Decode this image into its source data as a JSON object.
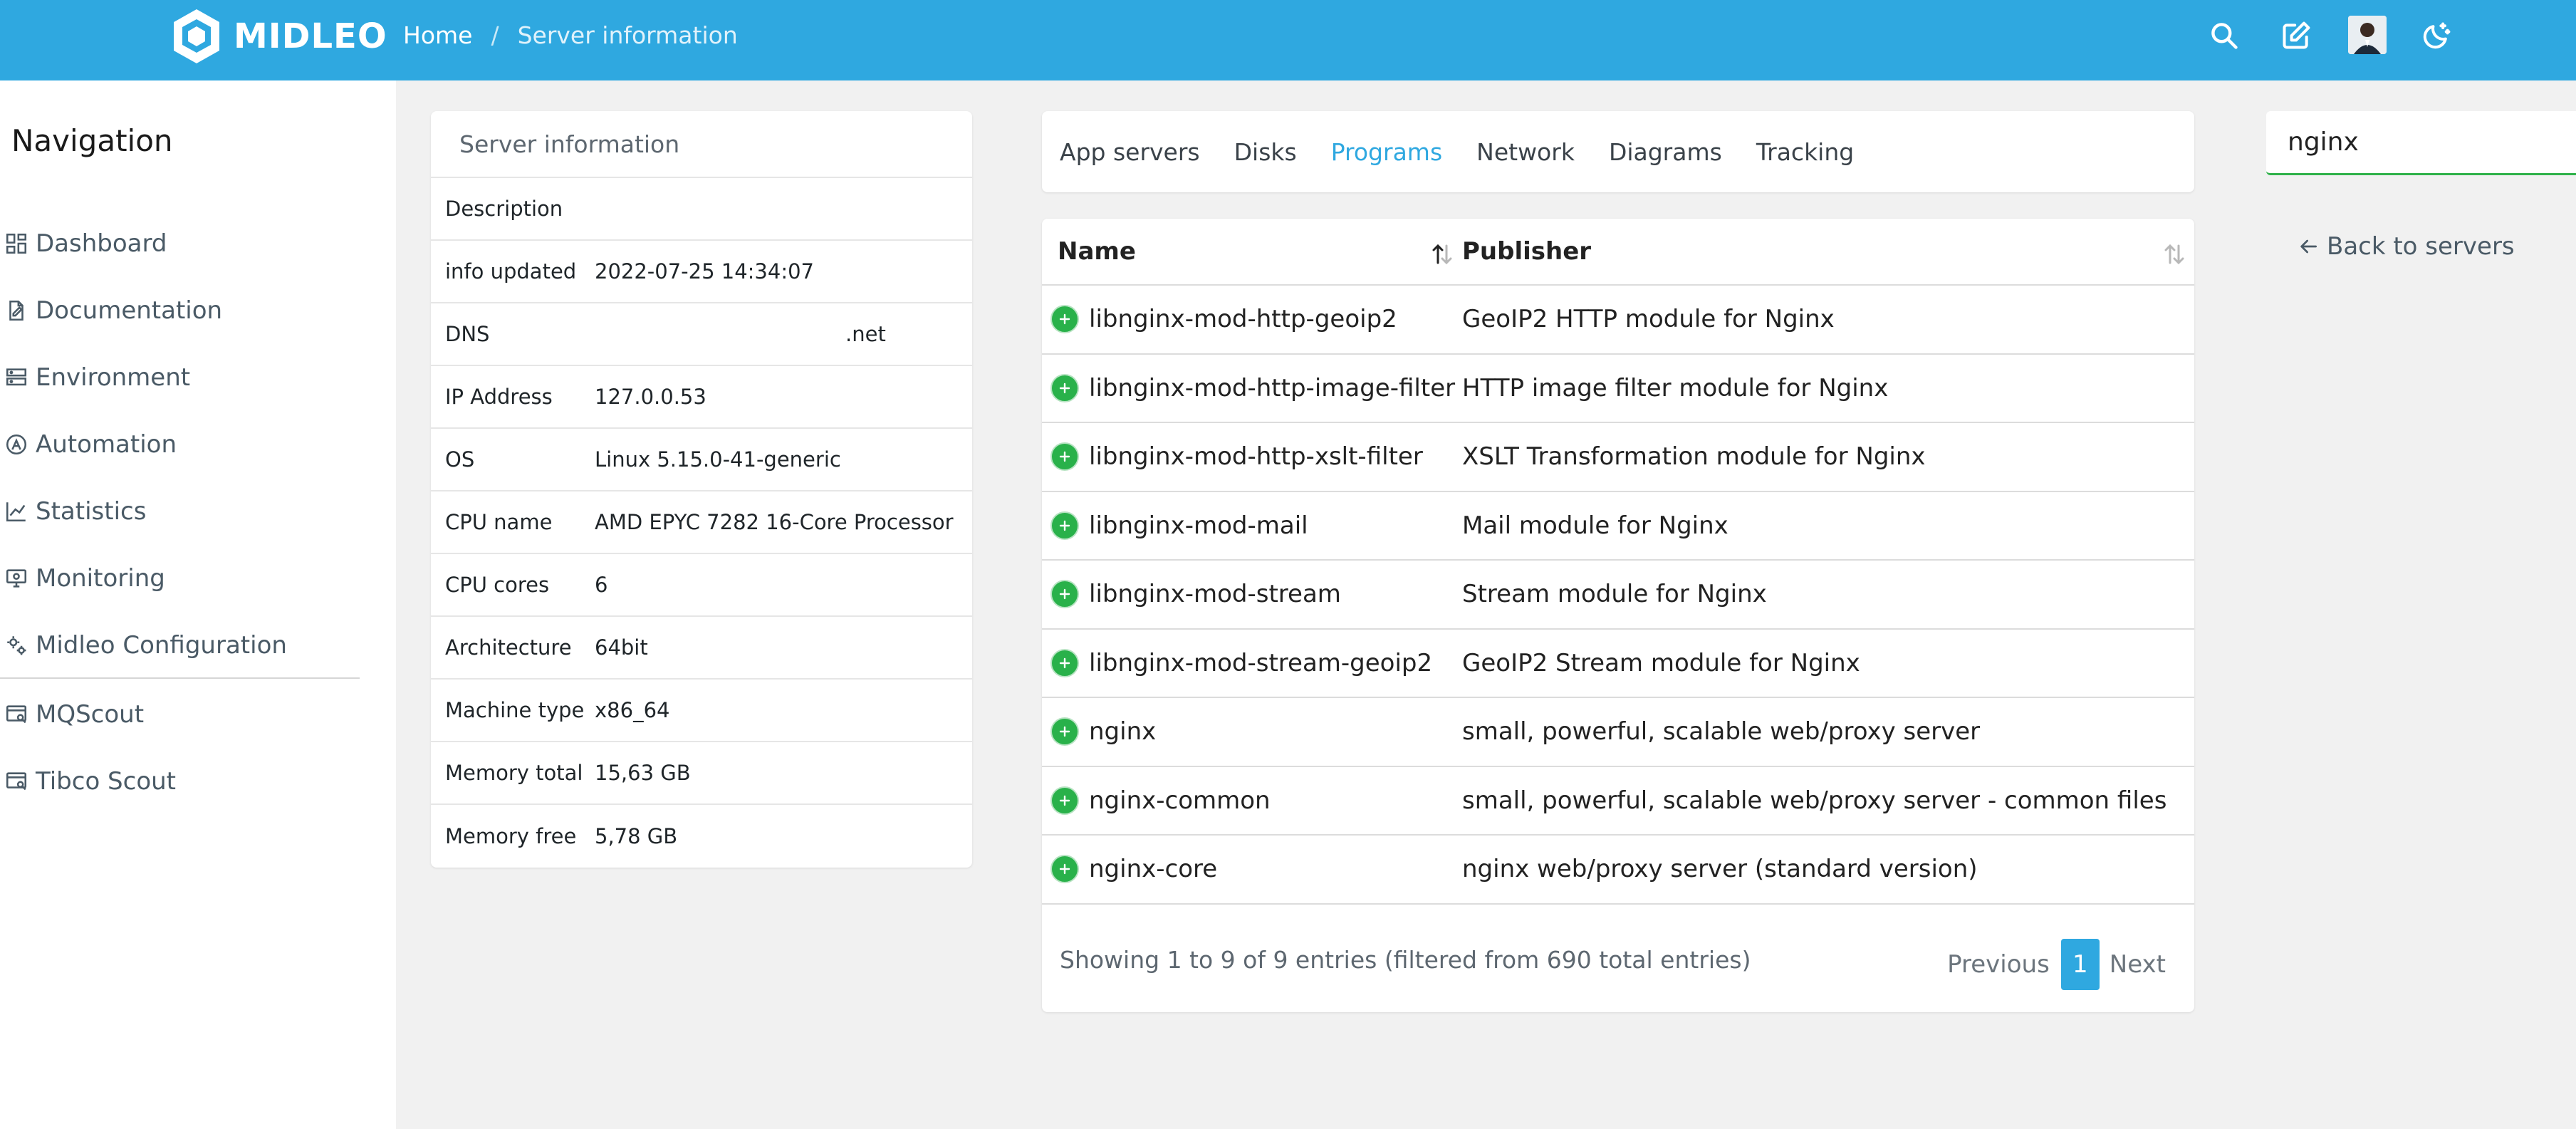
{
  "brand": {
    "name": "MIDLEO"
  },
  "breadcrumb": {
    "home": "Home",
    "separator": "/",
    "current": "Server information"
  },
  "topbar": {
    "icons": [
      "search-icon",
      "edit-icon",
      "avatar",
      "dark-mode-icon"
    ]
  },
  "sidebar": {
    "title": "Navigation",
    "items": [
      {
        "label": "Dashboard",
        "icon": "dashboard-icon"
      },
      {
        "label": "Documentation",
        "icon": "documentation-icon"
      },
      {
        "label": "Environment",
        "icon": "environment-icon"
      },
      {
        "label": "Automation",
        "icon": "automation-icon"
      },
      {
        "label": "Statistics",
        "icon": "statistics-icon"
      },
      {
        "label": "Monitoring",
        "icon": "monitoring-icon"
      },
      {
        "label": "Midleo Configuration",
        "icon": "config-icon"
      },
      {
        "label": "MQScout",
        "icon": "mqscout-icon"
      },
      {
        "label": "Tibco Scout",
        "icon": "tibcoscout-icon"
      }
    ]
  },
  "server_info": {
    "title": "Server information",
    "rows": [
      {
        "key": "Description",
        "value": ""
      },
      {
        "key": "info updated",
        "value": "2022-07-25 14:34:07"
      },
      {
        "key": "DNS",
        "value": ".net"
      },
      {
        "key": "IP Address",
        "value": "127.0.0.53"
      },
      {
        "key": "OS",
        "value": "Linux 5.15.0-41-generic"
      },
      {
        "key": "CPU name",
        "value": "AMD EPYC 7282 16-Core Processor"
      },
      {
        "key": "CPU cores",
        "value": "6"
      },
      {
        "key": "Architecture",
        "value": "64bit"
      },
      {
        "key": "Machine type",
        "value": "x86_64"
      },
      {
        "key": "Memory total",
        "value": "15,63 GB"
      },
      {
        "key": "Memory free",
        "value": "5,78 GB"
      }
    ]
  },
  "tabs": [
    {
      "label": "App servers",
      "active": false
    },
    {
      "label": "Disks",
      "active": false
    },
    {
      "label": "Programs",
      "active": true
    },
    {
      "label": "Network",
      "active": false
    },
    {
      "label": "Diagrams",
      "active": false
    },
    {
      "label": "Tracking",
      "active": false
    }
  ],
  "programs": {
    "columns": {
      "name": "Name",
      "publisher": "Publisher"
    },
    "rows": [
      {
        "name": "libnginx-mod-http-geoip2",
        "publisher": "GeoIP2 HTTP module for Nginx"
      },
      {
        "name": "libnginx-mod-http-image-filter",
        "publisher": "HTTP image filter module for Nginx"
      },
      {
        "name": "libnginx-mod-http-xslt-filter",
        "publisher": "XSLT Transformation module for Nginx"
      },
      {
        "name": "libnginx-mod-mail",
        "publisher": "Mail module for Nginx"
      },
      {
        "name": "libnginx-mod-stream",
        "publisher": "Stream module for Nginx"
      },
      {
        "name": "libnginx-mod-stream-geoip2",
        "publisher": "GeoIP2 Stream module for Nginx"
      },
      {
        "name": "nginx",
        "publisher": "small, powerful, scalable web/proxy server"
      },
      {
        "name": "nginx-common",
        "publisher": "small, powerful, scalable web/proxy server - common files"
      },
      {
        "name": "nginx-core",
        "publisher": "nginx web/proxy server (standard version)"
      }
    ],
    "footer": "Showing 1 to 9 of 9 entries (filtered from 690 total entries)",
    "pager": {
      "previous": "Previous",
      "current": "1",
      "next": "Next"
    }
  },
  "search": {
    "value": "nginx"
  },
  "back_link": {
    "label": "Back to servers"
  },
  "colors": {
    "accent": "#2fa8e0",
    "success": "#29b14a",
    "sidebar_bg": "#ffffff",
    "page_bg": "#f1f1f1"
  }
}
